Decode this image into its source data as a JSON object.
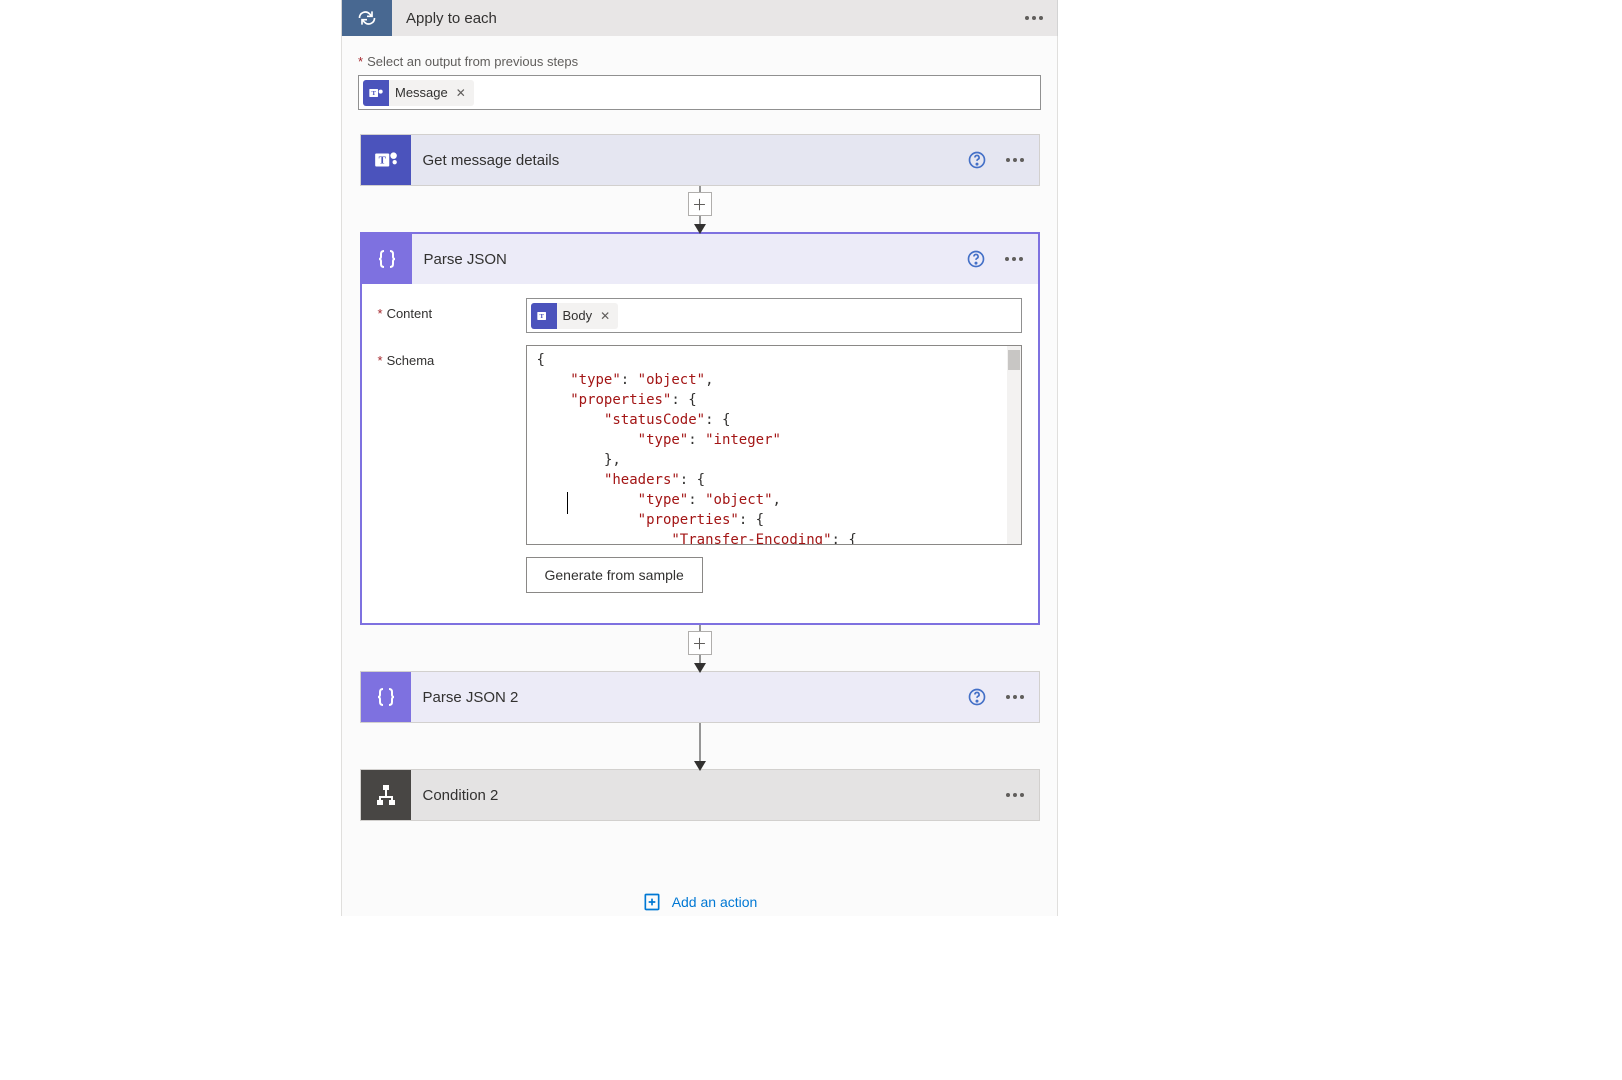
{
  "loop": {
    "title": "Apply to each",
    "outputLabel": "Select an output from previous steps",
    "token": {
      "label": "Message"
    }
  },
  "steps": {
    "getDetails": {
      "title": "Get message details"
    },
    "parseJson": {
      "title": "Parse JSON",
      "contentLabel": "Content",
      "contentToken": "Body",
      "schemaLabel": "Schema",
      "generateBtn": "Generate from sample",
      "schemaLines": [
        {
          "indent": 0,
          "parts": [
            {
              "t": "p",
              "v": "{"
            }
          ]
        },
        {
          "indent": 1,
          "parts": [
            {
              "t": "k",
              "v": "\"type\""
            },
            {
              "t": "p",
              "v": ": "
            },
            {
              "t": "s",
              "v": "\"object\""
            },
            {
              "t": "p",
              "v": ","
            }
          ]
        },
        {
          "indent": 1,
          "parts": [
            {
              "t": "k",
              "v": "\"properties\""
            },
            {
              "t": "p",
              "v": ": {"
            }
          ]
        },
        {
          "indent": 2,
          "parts": [
            {
              "t": "k",
              "v": "\"statusCode\""
            },
            {
              "t": "p",
              "v": ": {"
            }
          ]
        },
        {
          "indent": 3,
          "parts": [
            {
              "t": "k",
              "v": "\"type\""
            },
            {
              "t": "p",
              "v": ": "
            },
            {
              "t": "s",
              "v": "\"integer\""
            }
          ]
        },
        {
          "indent": 2,
          "parts": [
            {
              "t": "p",
              "v": "},"
            }
          ]
        },
        {
          "indent": 2,
          "parts": [
            {
              "t": "k",
              "v": "\"headers\""
            },
            {
              "t": "p",
              "v": ": {"
            }
          ]
        },
        {
          "indent": 3,
          "parts": [
            {
              "t": "k",
              "v": "\"type\""
            },
            {
              "t": "p",
              "v": ": "
            },
            {
              "t": "s",
              "v": "\"object\""
            },
            {
              "t": "p",
              "v": ","
            }
          ]
        },
        {
          "indent": 3,
          "parts": [
            {
              "t": "k",
              "v": "\"properties\""
            },
            {
              "t": "p",
              "v": ": {"
            }
          ]
        },
        {
          "indent": 4,
          "parts": [
            {
              "t": "k",
              "v": "\"Transfer-Encoding\""
            },
            {
              "t": "p",
              "v": ": {"
            }
          ]
        }
      ]
    },
    "parseJson2": {
      "title": "Parse JSON 2"
    },
    "condition2": {
      "title": "Condition 2"
    }
  },
  "addAction": "Add an action",
  "colors": {
    "teams": "#4b53bc",
    "purple": "#7e71e0",
    "dark": "#484644",
    "headerBlue": "#486891",
    "link": "#0078d4"
  }
}
